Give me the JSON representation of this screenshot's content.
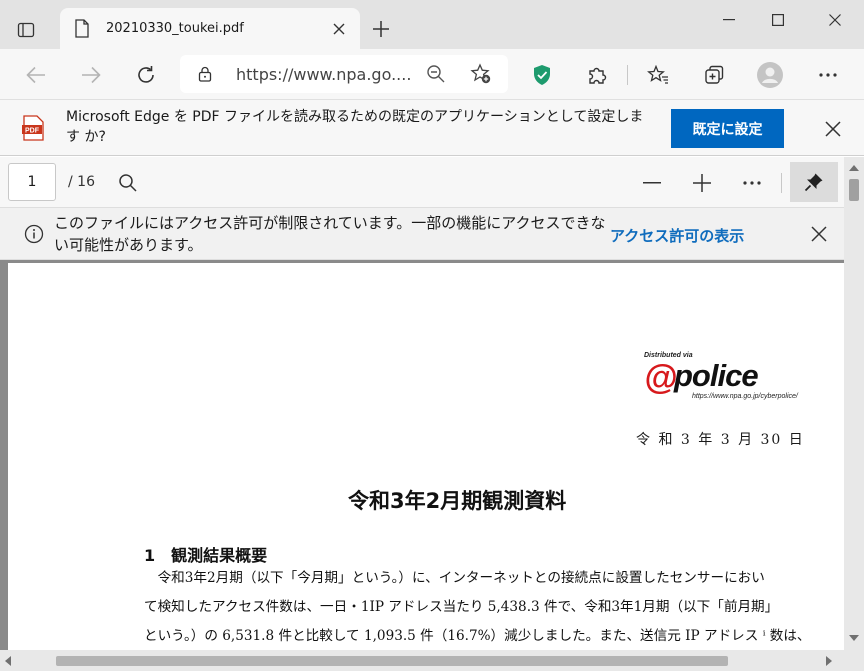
{
  "tab": {
    "title": "20210330_toukei.pdf"
  },
  "addressbar": {
    "url": "https://www.npa.go...."
  },
  "infobar": {
    "message": "Microsoft Edge を PDF ファイルを読み取るための既定のアプリケーションとして設定します か?",
    "button_label": "既定に設定",
    "pdf_badge": "PDF"
  },
  "pdf_toolbar": {
    "page_current": "1",
    "page_total": "/ 16"
  },
  "access_warning": {
    "message": "このファイルにはアクセス許可が制限されています。一部の機能にアクセスできない可能性があります。",
    "link_label": "アクセス許可の表示"
  },
  "document": {
    "logo": {
      "distributed_via": "Distributed via",
      "at_mark": "@",
      "brand": "police",
      "url": "https://www.npa.go.jp/cyberpolice/"
    },
    "date": "令 和 3 年 3 月 30 日",
    "title": "令和3年2月期観測資料",
    "section_heading": "1　観測結果概要",
    "paragraph_lines": [
      "　令和3年2月期（以下「今月期」という。）に、インターネットとの接続点に設置したセンサーにおい",
      "て検知したアクセス件数は、一日・1IP アドレス当たり 5,438.3 件で、令和3年1月期（以下「前月期」",
      "という。）の 6,531.8 件と比較して 1,093.5 件（16.7%）減少しました。また、送信元 IP アドレス ⁱ 数は、"
    ]
  },
  "colors": {
    "accent": "#0067c0",
    "link": "#0f6cbd",
    "logo_red": "#d7191c",
    "shield_green": "#1e9b6e"
  }
}
